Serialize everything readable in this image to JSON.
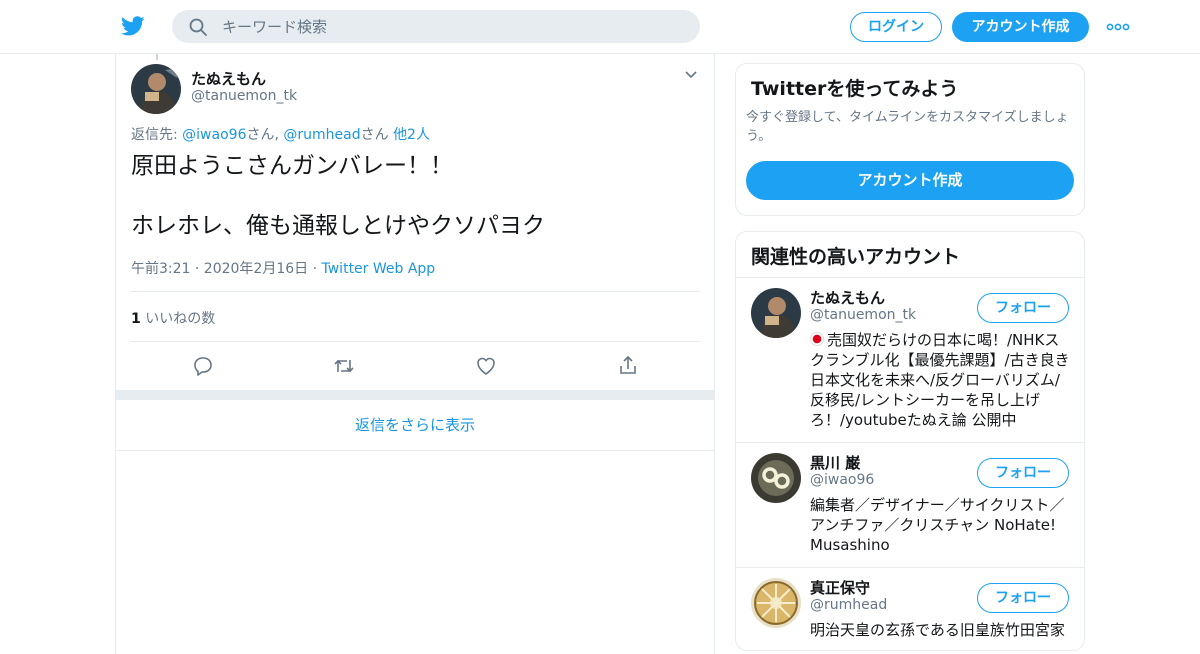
{
  "header": {
    "search_placeholder": "キーワード検索",
    "login_label": "ログイン",
    "signup_label": "アカウント作成",
    "brand_color": "#1da1f2"
  },
  "tweet": {
    "author_name": "たぬえもん",
    "author_handle": "@tanuemon_tk",
    "reply_prefix": "返信先: ",
    "reply_user1": "@iwao96",
    "reply_san1": "さん, ",
    "reply_user2": "@rumhead",
    "reply_san2": "さん ",
    "reply_others": "他2人",
    "text_line1": "原田ようこさんガンバレー！！",
    "text_line2": "ホレホレ、俺も通報しとけやクソパヨク",
    "timestamp": "午前3:21 · 2020年2月16日 · ",
    "source_app": "Twitter Web App",
    "likes_count": "1",
    "likes_label": " いいねの数",
    "show_more_replies": "返信をさらに表示"
  },
  "sidebar": {
    "signup_card": {
      "title": "Twitterを使ってみよう",
      "subtitle": "今すぐ登録して、タイムラインをカスタマイズしましょう。",
      "button_label": "アカウント作成"
    },
    "related": {
      "title": "関連性の高いアカウント",
      "follow_label": "フォロー",
      "accounts": [
        {
          "name": "たぬえもん",
          "handle": "@tanuemon_tk",
          "bio": "売国奴だらけの日本に喝！/NHKスクランブル化【最優先課題】/古き良き日本文化を未来へ/反グローバリズム/反移民/レントシーカーを吊し上げろ！/youtubeたぬえ論 公開中"
        },
        {
          "name": "黒川 巌",
          "handle": "@iwao96",
          "bio": "編集者／デザイナー／サイクリスト／アンチファ／クリスチャン NoHate! Musashino"
        },
        {
          "name": "真正保守",
          "handle": "@rumhead",
          "bio": "明治天皇の玄孫である旧皇族竹田宮家"
        }
      ]
    }
  }
}
